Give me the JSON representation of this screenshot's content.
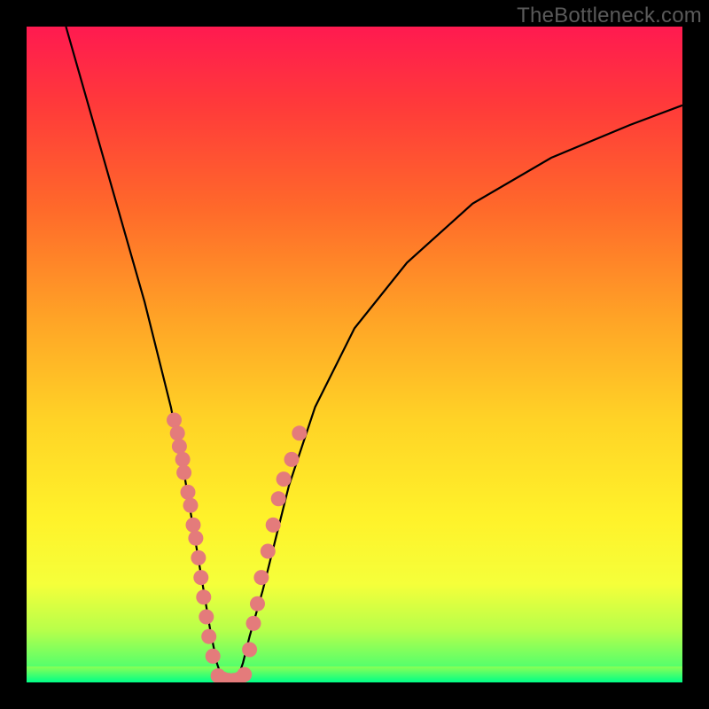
{
  "watermark": "TheBottleneck.com",
  "chart_data": {
    "type": "line",
    "title": "",
    "xlabel": "",
    "ylabel": "",
    "xlim": [
      0,
      100
    ],
    "ylim": [
      0,
      100
    ],
    "grid": false,
    "series": [
      {
        "name": "curve",
        "x": [
          6,
          10,
          14,
          18,
          20,
          22,
          24,
          25,
          26,
          27,
          28,
          29,
          30,
          31,
          32,
          33,
          34,
          36,
          38,
          40,
          44,
          50,
          58,
          68,
          80,
          92,
          100
        ],
        "y": [
          100,
          86,
          72,
          58,
          50,
          42,
          32,
          26,
          20,
          14,
          8,
          3,
          0,
          0,
          0,
          3,
          7,
          14,
          22,
          30,
          42,
          54,
          64,
          73,
          80,
          85,
          88
        ]
      }
    ],
    "points": [
      {
        "name": "left-cluster",
        "xy": [
          [
            22.5,
            40
          ],
          [
            23.0,
            38
          ],
          [
            23.3,
            36
          ],
          [
            23.8,
            34
          ],
          [
            24.0,
            32
          ],
          [
            24.6,
            29
          ],
          [
            25.0,
            27
          ],
          [
            25.4,
            24
          ],
          [
            25.8,
            22
          ],
          [
            26.2,
            19
          ],
          [
            26.6,
            16
          ],
          [
            27.0,
            13
          ],
          [
            27.4,
            10
          ],
          [
            27.8,
            7
          ],
          [
            28.4,
            4
          ]
        ]
      },
      {
        "name": "bottom-cluster",
        "xy": [
          [
            29.2,
            1
          ],
          [
            30.0,
            0.5
          ],
          [
            30.8,
            0.3
          ],
          [
            31.6,
            0.3
          ],
          [
            32.4,
            0.5
          ],
          [
            33.2,
            1.2
          ]
        ]
      },
      {
        "name": "right-cluster",
        "xy": [
          [
            34.0,
            5
          ],
          [
            34.6,
            9
          ],
          [
            35.2,
            12
          ],
          [
            35.8,
            16
          ],
          [
            36.8,
            20
          ],
          [
            37.6,
            24
          ],
          [
            38.4,
            28
          ],
          [
            39.2,
            31
          ],
          [
            40.4,
            34
          ],
          [
            41.6,
            38
          ]
        ]
      }
    ],
    "colors": {
      "curve": "#000000",
      "points": "#e47b7b",
      "gradient_top": "#ff1a50",
      "gradient_mid": "#ffd326",
      "gradient_bottom": "#00ff88"
    }
  }
}
